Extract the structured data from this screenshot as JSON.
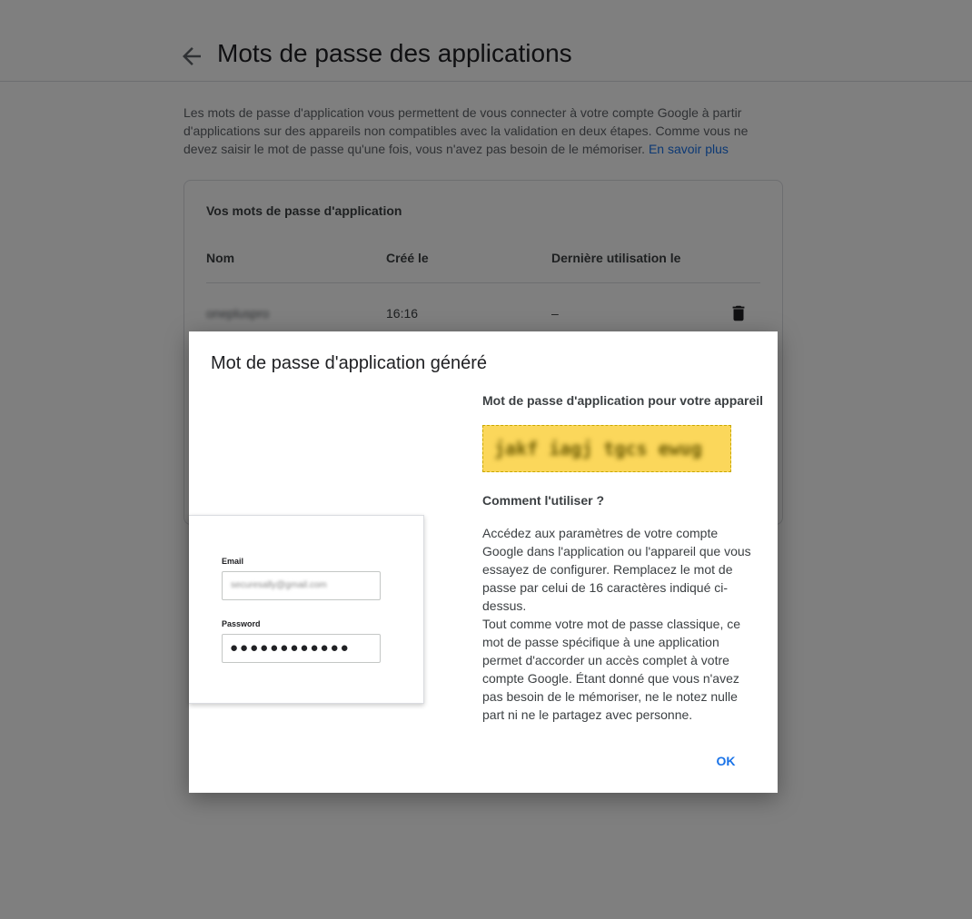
{
  "header": {
    "title": "Mots de passe des applications",
    "back_icon": "arrow-back-icon"
  },
  "intro": {
    "text": "Les mots de passe d'application vous permettent de vous connecter à votre compte Google à partir d'applications sur des appareils non compatibles avec la validation en deux étapes. Comme vous ne devez saisir le mot de passe qu'une fois, vous n'avez pas besoin de le mémoriser. ",
    "link": "En savoir plus"
  },
  "card": {
    "title": "Vos mots de passe d'application",
    "columns": [
      "Nom",
      "Créé le",
      "Dernière utilisation le"
    ],
    "rows": [
      {
        "name": "oneplusprо",
        "created": "16:16",
        "last_used": "–",
        "action_icon": "trash-icon"
      }
    ]
  },
  "dialog": {
    "title": "Mot de passe d'application généré",
    "password_heading": "Mot de passe d'application pour votre appareil",
    "password": "jakf iagj tgcs ewug",
    "password_highlight_color": "#fbd75b",
    "how_heading": "Comment l'utiliser ?",
    "how_text_1": "Accédez aux paramètres de votre compte Google dans l'application ou l'appareil que vous essayez de configurer. Remplacez le mot de passe par celui de 16 caractères indiqué ci-dessus.",
    "how_text_2": "Tout comme votre mot de passe classique, ce mot de passe spécifique à une application permet d'accorder un accès complet à votre compte Google. Étant donné que vous n'avez pas besoin de le mémoriser, ne le notez nulle part ni ne le partagez avec personne.",
    "ok_label": "OK",
    "illustration": {
      "email_label": "Email",
      "email_value": "securesally@gmail.com",
      "password_label": "Password",
      "password_value": "●●●●●●●●●●●●"
    }
  },
  "colors": {
    "link": "#1a73e8",
    "overlay": "rgba(0,0,0,0.5)"
  }
}
